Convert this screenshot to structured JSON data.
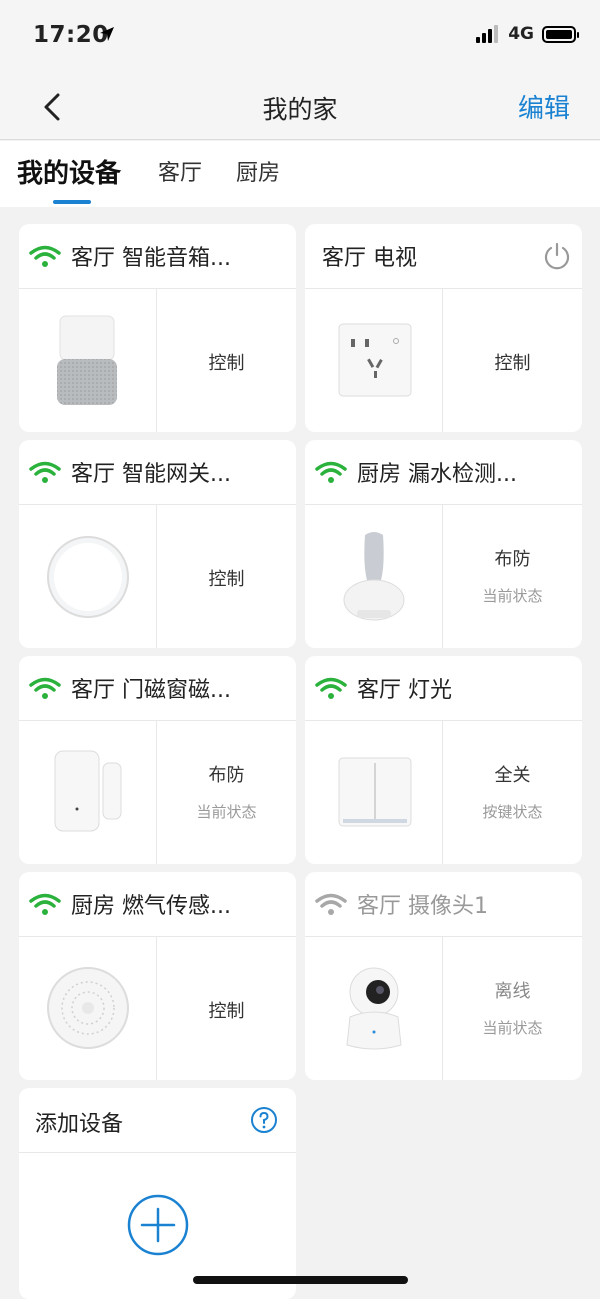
{
  "status": {
    "time": "17:20",
    "network": "4G"
  },
  "nav": {
    "title": "我的家",
    "edit": "编辑"
  },
  "tabs": [
    "我的设备",
    "客厅",
    "厨房"
  ],
  "devices": [
    {
      "title": "客厅 智能音箱...",
      "online": true,
      "main": "控制",
      "sub": "",
      "icon": "smart-speaker-icon"
    },
    {
      "title": "客厅 电视",
      "online": false,
      "power": true,
      "main": "控制",
      "sub": "",
      "icon": "wall-socket-icon"
    },
    {
      "title": "客厅 智能网关...",
      "online": true,
      "main": "控制",
      "sub": "",
      "icon": "gateway-icon"
    },
    {
      "title": "厨房 漏水检测...",
      "online": true,
      "main": "布防",
      "sub": "当前状态",
      "icon": "water-leak-sensor-icon"
    },
    {
      "title": "客厅 门磁窗磁...",
      "online": true,
      "main": "布防",
      "sub": "当前状态",
      "icon": "door-sensor-icon"
    },
    {
      "title": "客厅 灯光",
      "online": true,
      "main": "全关",
      "sub": "按键状态",
      "icon": "light-switch-icon"
    },
    {
      "title": "厨房 燃气传感...",
      "online": true,
      "main": "控制",
      "sub": "",
      "icon": "gas-sensor-icon"
    },
    {
      "title": "客厅 摄像头1",
      "online": false,
      "offline_style": true,
      "main": "离线",
      "sub": "当前状态",
      "icon": "camera-icon"
    }
  ],
  "add_device": {
    "title": "添加设备"
  },
  "colors": {
    "accent": "#1b82d2",
    "wifi_on": "#2bb23c",
    "wifi_off": "#a8a8a8"
  }
}
